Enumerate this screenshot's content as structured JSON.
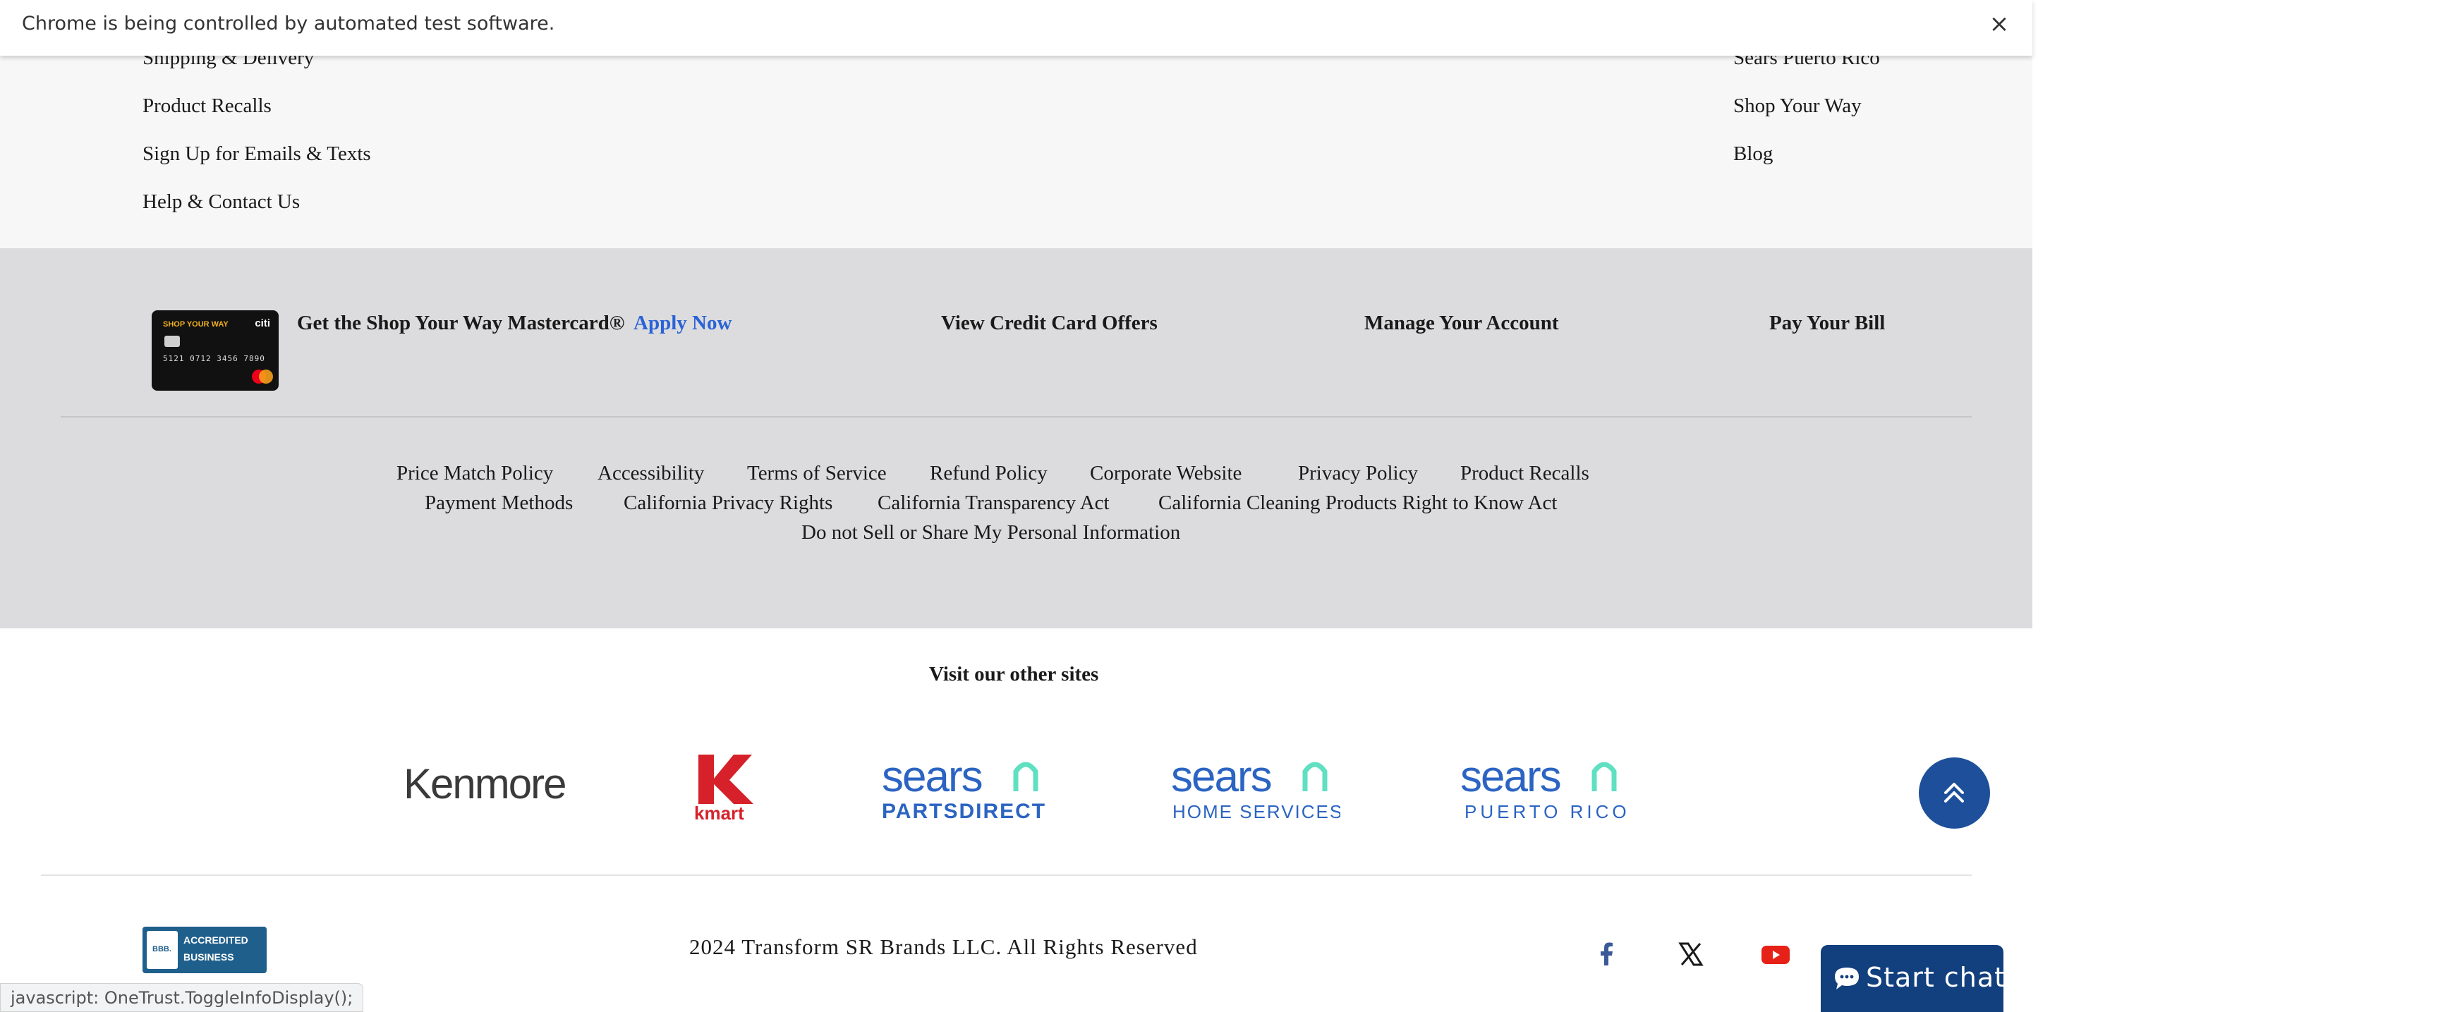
{
  "browser": {
    "automation_message": "Chrome is being controlled by automated test software.",
    "close_label": "×",
    "status_url": "javascript: OneTrust.ToggleInfoDisplay();"
  },
  "footer_links": {
    "left": [
      "Shipping & Delivery",
      "Product Recalls",
      "Sign Up for Emails & Texts",
      "Help & Contact Us"
    ],
    "right": [
      "Sears Puerto Rico",
      "Shop Your Way",
      "Blog"
    ]
  },
  "credit": {
    "card_brand": "SHOP YOUR WAY",
    "card_issuer": "citi",
    "card_number": "5121 0712 3456 7890",
    "promo_text": "Get the Shop Your Way Mastercard®",
    "apply_label": "Apply Now",
    "offers_label": "View Credit Card Offers",
    "manage_label": "Manage Your Account",
    "pay_label": "Pay Your Bill"
  },
  "policies": {
    "row1": [
      "Price Match Policy",
      "Accessibility",
      "Terms of Service",
      "Refund Policy",
      "Corporate Website",
      "Privacy Policy",
      "Product Recalls"
    ],
    "row2": [
      "Payment Methods",
      "California Privacy Rights",
      "California Transparency Act",
      "California Cleaning Products Right to Know Act"
    ],
    "row3": [
      "Do not Sell or Share My Personal Information"
    ]
  },
  "other_sites": {
    "title": "Visit our other sites",
    "logos": {
      "kenmore": "Kenmore",
      "kmart": "kmart",
      "sears1_main": "sears",
      "sears1_sub": "PARTSDIRECT",
      "sears2_main": "sears",
      "sears2_sub": "HOME SERVICES",
      "sears3_main": "sears",
      "sears3_sub": "PUERTO RICO"
    }
  },
  "bottom": {
    "bbb_line1": "ACCREDITED",
    "bbb_line2": "BUSINESS",
    "bbb_seal": "BBB.",
    "copyright": "2024 Transform SR Brands LLC. All Rights Reserved",
    "chat_label": "Start chat"
  },
  "colors": {
    "link_blue": "#2a63d6",
    "brand_navy": "#1d4f9b",
    "sears_blue": "#2b64c2",
    "sears_teal": "#5fe0c0",
    "kmart_red": "#d6212b",
    "youtube_red": "#e62117",
    "facebook_blue": "#3b5998"
  },
  "icons": {
    "close": "close-icon",
    "scroll_top": "chevron-double-up-icon",
    "facebook": "facebook-icon",
    "x": "x-twitter-icon",
    "youtube": "youtube-icon",
    "chat": "chat-bubble-icon"
  }
}
